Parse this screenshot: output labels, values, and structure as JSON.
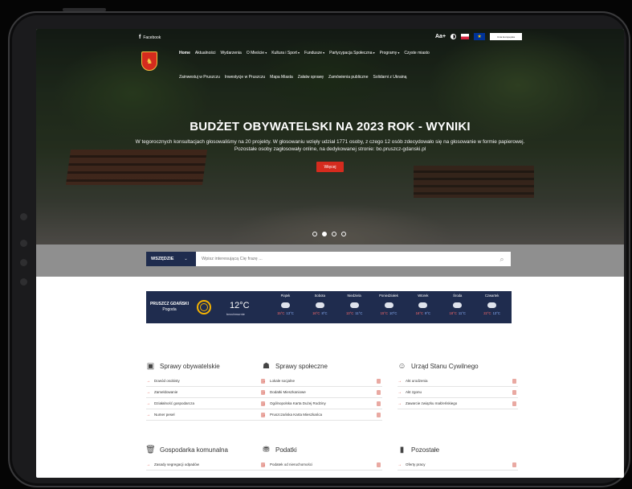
{
  "header": {
    "facebook_label": "Facebook",
    "font_size_label": "Aa+",
    "eu_label": "Unia Europejska"
  },
  "nav": {
    "items": [
      {
        "label": "Home",
        "active": true,
        "dropdown": false
      },
      {
        "label": "Aktualności",
        "active": false,
        "dropdown": false
      },
      {
        "label": "Wydarzenia",
        "active": false,
        "dropdown": false
      },
      {
        "label": "O Mieście",
        "active": false,
        "dropdown": true
      },
      {
        "label": "Kultura i Sport",
        "active": false,
        "dropdown": true
      },
      {
        "label": "Fundusze",
        "active": false,
        "dropdown": true
      },
      {
        "label": "Partycypacja Społeczna",
        "active": false,
        "dropdown": true
      },
      {
        "label": "Programy",
        "active": false,
        "dropdown": true
      },
      {
        "label": "Czyste miasto",
        "active": false,
        "dropdown": false
      },
      {
        "label": "Zainwestuj w Pruszczu",
        "active": false,
        "dropdown": false
      },
      {
        "label": "Inwestycje w Pruszczu",
        "active": false,
        "dropdown": false
      },
      {
        "label": "Mapa Miasta",
        "active": false,
        "dropdown": false
      },
      {
        "label": "Załatw sprawę",
        "active": false,
        "dropdown": false
      },
      {
        "label": "Zamówienia publiczne",
        "active": false,
        "dropdown": false
      },
      {
        "label": "Solidarni z Ukrainą",
        "active": false,
        "dropdown": false
      }
    ]
  },
  "hero": {
    "title": "BUDŻET OBYWATELSKI NA 2023 ROK - WYNIKI",
    "description": "W tegorocznych konsultacjach głosowaliśmy na 20 projekty. W głosowaniu wzięły udział 1771 osoby, z czego 12 osób zdecydowało się na głosowanie w formie papierowej. Pozostałe osoby zagłosowały online, na dedykowanej stronie: bo.pruszcz-gdanski.pl",
    "button_label": "Więcej",
    "slide_count": 4,
    "active_slide": 2
  },
  "search": {
    "scope_label": "WSZĘDZIE",
    "placeholder": "Wpisz interesującą Cię frazę ..."
  },
  "weather": {
    "city": "PRUSZCZ GDAŃSKI",
    "subtitle": "Pogoda",
    "temperature": "12°C",
    "condition": "bezchmurnie",
    "days": [
      {
        "name": "Piątek",
        "hi": "15°C",
        "lo": "13°C"
      },
      {
        "name": "Sobota",
        "hi": "16°C",
        "lo": "8°C"
      },
      {
        "name": "Niedziela",
        "hi": "13°C",
        "lo": "11°C"
      },
      {
        "name": "Poniedziałek",
        "hi": "15°C",
        "lo": "10°C"
      },
      {
        "name": "Wtorek",
        "hi": "16°C",
        "lo": "9°C"
      },
      {
        "name": "Środa",
        "hi": "18°C",
        "lo": "11°C"
      },
      {
        "name": "Czwartek",
        "hi": "22°C",
        "lo": "13°C"
      }
    ]
  },
  "categories": [
    {
      "title": "Sprawy obywatelskie",
      "icon": "id-card-icon",
      "items": [
        "Dowód osobisty",
        "Zameldowanie",
        "Działalność gospodarcza",
        "Numer pesel"
      ]
    },
    {
      "title": "Sprawy społeczne",
      "icon": "people-icon",
      "items": [
        "Lokale socjalne",
        "Dodatki Mieszkaniowe",
        "Ogólnopolska Karta Dużej Rodziny",
        "Pruszczańska Karta Mieszkańca"
      ]
    },
    {
      "title": "Urząd Stanu Cywilnego",
      "icon": "family-icon",
      "items": [
        "Akt urodzenia",
        "Akt zgonu",
        "Zawarcie związku małżeńskiego"
      ]
    },
    {
      "title": "Gospodarka komunalna",
      "icon": "trash-icon",
      "items": [
        "Zasady segregacji odpadów"
      ]
    },
    {
      "title": "Podatki",
      "icon": "tax-icon",
      "items": [
        "Podatek od nieruchomości"
      ]
    },
    {
      "title": "Pozostałe",
      "icon": "document-icon",
      "items": [
        "Oferty pracy"
      ]
    }
  ]
}
